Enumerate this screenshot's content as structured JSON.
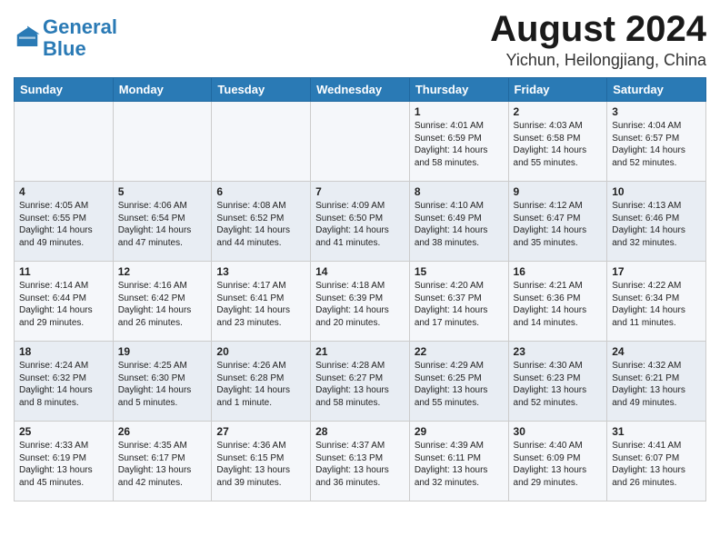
{
  "header": {
    "logo_line1": "General",
    "logo_line2": "Blue",
    "month": "August 2024",
    "location": "Yichun, Heilongjiang, China"
  },
  "days_of_week": [
    "Sunday",
    "Monday",
    "Tuesday",
    "Wednesday",
    "Thursday",
    "Friday",
    "Saturday"
  ],
  "weeks": [
    [
      {
        "day": "",
        "detail": ""
      },
      {
        "day": "",
        "detail": ""
      },
      {
        "day": "",
        "detail": ""
      },
      {
        "day": "",
        "detail": ""
      },
      {
        "day": "1",
        "detail": "Sunrise: 4:01 AM\nSunset: 6:59 PM\nDaylight: 14 hours\nand 58 minutes."
      },
      {
        "day": "2",
        "detail": "Sunrise: 4:03 AM\nSunset: 6:58 PM\nDaylight: 14 hours\nand 55 minutes."
      },
      {
        "day": "3",
        "detail": "Sunrise: 4:04 AM\nSunset: 6:57 PM\nDaylight: 14 hours\nand 52 minutes."
      }
    ],
    [
      {
        "day": "4",
        "detail": "Sunrise: 4:05 AM\nSunset: 6:55 PM\nDaylight: 14 hours\nand 49 minutes."
      },
      {
        "day": "5",
        "detail": "Sunrise: 4:06 AM\nSunset: 6:54 PM\nDaylight: 14 hours\nand 47 minutes."
      },
      {
        "day": "6",
        "detail": "Sunrise: 4:08 AM\nSunset: 6:52 PM\nDaylight: 14 hours\nand 44 minutes."
      },
      {
        "day": "7",
        "detail": "Sunrise: 4:09 AM\nSunset: 6:50 PM\nDaylight: 14 hours\nand 41 minutes."
      },
      {
        "day": "8",
        "detail": "Sunrise: 4:10 AM\nSunset: 6:49 PM\nDaylight: 14 hours\nand 38 minutes."
      },
      {
        "day": "9",
        "detail": "Sunrise: 4:12 AM\nSunset: 6:47 PM\nDaylight: 14 hours\nand 35 minutes."
      },
      {
        "day": "10",
        "detail": "Sunrise: 4:13 AM\nSunset: 6:46 PM\nDaylight: 14 hours\nand 32 minutes."
      }
    ],
    [
      {
        "day": "11",
        "detail": "Sunrise: 4:14 AM\nSunset: 6:44 PM\nDaylight: 14 hours\nand 29 minutes."
      },
      {
        "day": "12",
        "detail": "Sunrise: 4:16 AM\nSunset: 6:42 PM\nDaylight: 14 hours\nand 26 minutes."
      },
      {
        "day": "13",
        "detail": "Sunrise: 4:17 AM\nSunset: 6:41 PM\nDaylight: 14 hours\nand 23 minutes."
      },
      {
        "day": "14",
        "detail": "Sunrise: 4:18 AM\nSunset: 6:39 PM\nDaylight: 14 hours\nand 20 minutes."
      },
      {
        "day": "15",
        "detail": "Sunrise: 4:20 AM\nSunset: 6:37 PM\nDaylight: 14 hours\nand 17 minutes."
      },
      {
        "day": "16",
        "detail": "Sunrise: 4:21 AM\nSunset: 6:36 PM\nDaylight: 14 hours\nand 14 minutes."
      },
      {
        "day": "17",
        "detail": "Sunrise: 4:22 AM\nSunset: 6:34 PM\nDaylight: 14 hours\nand 11 minutes."
      }
    ],
    [
      {
        "day": "18",
        "detail": "Sunrise: 4:24 AM\nSunset: 6:32 PM\nDaylight: 14 hours\nand 8 minutes."
      },
      {
        "day": "19",
        "detail": "Sunrise: 4:25 AM\nSunset: 6:30 PM\nDaylight: 14 hours\nand 5 minutes."
      },
      {
        "day": "20",
        "detail": "Sunrise: 4:26 AM\nSunset: 6:28 PM\nDaylight: 14 hours\nand 1 minute."
      },
      {
        "day": "21",
        "detail": "Sunrise: 4:28 AM\nSunset: 6:27 PM\nDaylight: 13 hours\nand 58 minutes."
      },
      {
        "day": "22",
        "detail": "Sunrise: 4:29 AM\nSunset: 6:25 PM\nDaylight: 13 hours\nand 55 minutes."
      },
      {
        "day": "23",
        "detail": "Sunrise: 4:30 AM\nSunset: 6:23 PM\nDaylight: 13 hours\nand 52 minutes."
      },
      {
        "day": "24",
        "detail": "Sunrise: 4:32 AM\nSunset: 6:21 PM\nDaylight: 13 hours\nand 49 minutes."
      }
    ],
    [
      {
        "day": "25",
        "detail": "Sunrise: 4:33 AM\nSunset: 6:19 PM\nDaylight: 13 hours\nand 45 minutes."
      },
      {
        "day": "26",
        "detail": "Sunrise: 4:35 AM\nSunset: 6:17 PM\nDaylight: 13 hours\nand 42 minutes."
      },
      {
        "day": "27",
        "detail": "Sunrise: 4:36 AM\nSunset: 6:15 PM\nDaylight: 13 hours\nand 39 minutes."
      },
      {
        "day": "28",
        "detail": "Sunrise: 4:37 AM\nSunset: 6:13 PM\nDaylight: 13 hours\nand 36 minutes."
      },
      {
        "day": "29",
        "detail": "Sunrise: 4:39 AM\nSunset: 6:11 PM\nDaylight: 13 hours\nand 32 minutes."
      },
      {
        "day": "30",
        "detail": "Sunrise: 4:40 AM\nSunset: 6:09 PM\nDaylight: 13 hours\nand 29 minutes."
      },
      {
        "day": "31",
        "detail": "Sunrise: 4:41 AM\nSunset: 6:07 PM\nDaylight: 13 hours\nand 26 minutes."
      }
    ]
  ]
}
